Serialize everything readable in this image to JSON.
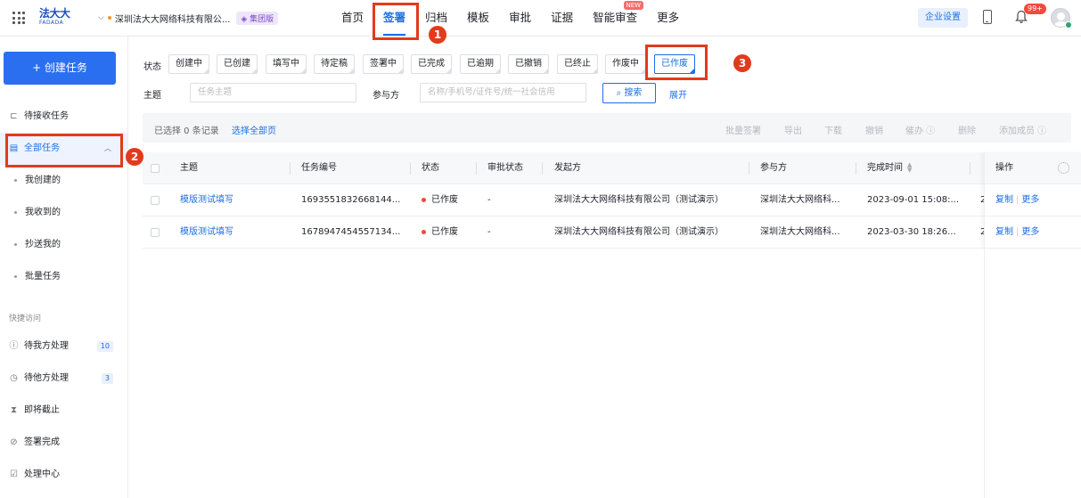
{
  "header": {
    "logo_cn": "法大大",
    "logo_en": "FADADA",
    "org_name": "深圳法大大网络科技有限公...",
    "org_badge": "集团版",
    "nav": [
      {
        "label": "首页"
      },
      {
        "label": "签署",
        "active": true
      },
      {
        "label": "归档"
      },
      {
        "label": "模板"
      },
      {
        "label": "审批"
      },
      {
        "label": "证据"
      },
      {
        "label": "智能审查",
        "tag": "NEW"
      },
      {
        "label": "更多"
      }
    ],
    "enterprise_settings": "企业设置",
    "notification_count": "99+"
  },
  "sidebar": {
    "create_task": "+ 创建任务",
    "pending_receive": "待接收任务",
    "all_tasks": "全部任务",
    "sub_items": [
      "我创建的",
      "我收到的",
      "抄送我的",
      "批量任务"
    ],
    "quick_access_title": "快捷访问",
    "quick_items": [
      {
        "label": "待我方处理",
        "count": "10"
      },
      {
        "label": "待他方处理",
        "count": "3"
      },
      {
        "label": "即将截止"
      },
      {
        "label": "签署完成"
      },
      {
        "label": "处理中心"
      }
    ]
  },
  "filters": {
    "status_label": "状态",
    "statuses": [
      "创建中",
      "已创建",
      "填写中",
      "待定稿",
      "签署中",
      "已完成",
      "已逾期",
      "已撤销",
      "已终止",
      "作废中",
      "已作废"
    ],
    "active_status": "已作废",
    "subject_label": "主题",
    "subject_placeholder": "任务主题",
    "participant_label": "参与方",
    "participant_placeholder": "名称/手机号/证件号/统一社会信用",
    "search_button": "搜索",
    "expand": "展开"
  },
  "action_bar": {
    "selected_info": "已选择 0 条记录",
    "select_all": "选择全部页",
    "actions": [
      "批量签署",
      "导出",
      "下载",
      "撤销",
      "催办",
      "删除",
      "添加成员"
    ]
  },
  "table": {
    "columns": [
      "主题",
      "任务编号",
      "状态",
      "审批状态",
      "发起方",
      "参与方",
      "完成时间",
      "操作"
    ],
    "rows": [
      {
        "subject": "模版测试填写",
        "task_no": "1693551832668144...",
        "status": "已作废",
        "approval": "-",
        "initiator": "深圳法大大网络科技有限公司（测试演示）",
        "participant": "深圳法大大网络科...",
        "finish_time": "2023-09-01 15:08:...",
        "trunc": "2",
        "op_copy": "复制",
        "op_more": "更多"
      },
      {
        "subject": "模版测试填写",
        "task_no": "1678947454557134...",
        "status": "已作废",
        "approval": "-",
        "initiator": "深圳法大大网络科技有限公司（测试演示）",
        "participant": "深圳法大大网络科...",
        "finish_time": "2023-03-30 18:26...",
        "trunc": "2",
        "op_copy": "复制",
        "op_more": "更多"
      }
    ]
  },
  "steps": [
    "1",
    "2",
    "3"
  ],
  "colors": {
    "accent": "#1d6ee6",
    "highlight": "#e23a1c",
    "status_void": "#f5493d"
  }
}
